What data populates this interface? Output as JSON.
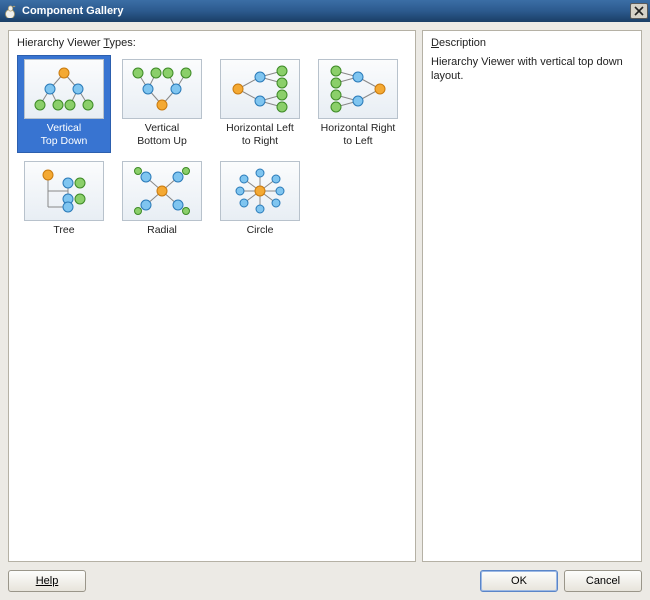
{
  "titlebar": {
    "title": "Component Gallery"
  },
  "leftPanel": {
    "label_prefix": "Hierarchy Viewer ",
    "label_accel": "T",
    "label_suffix": "ypes:"
  },
  "rightPanel": {
    "label_accel": "D",
    "label_suffix": "escription"
  },
  "description": "Hierarchy Viewer with vertical top down layout.",
  "gallery": [
    {
      "id": "vertical-top-down",
      "line1": "Vertical",
      "line2": "Top Down",
      "selected": true
    },
    {
      "id": "vertical-bottom-up",
      "line1": "Vertical",
      "line2": "Bottom Up",
      "selected": false
    },
    {
      "id": "horizontal-ltr",
      "line1": "Horizontal Left",
      "line2": "to Right",
      "selected": false
    },
    {
      "id": "horizontal-rtl",
      "line1": "Horizontal Right",
      "line2": "to Left",
      "selected": false
    },
    {
      "id": "tree",
      "line1": "Tree",
      "line2": "",
      "selected": false
    },
    {
      "id": "radial",
      "line1": "Radial",
      "line2": "",
      "selected": false
    },
    {
      "id": "circle",
      "line1": "Circle",
      "line2": "",
      "selected": false
    }
  ],
  "buttons": {
    "help": "Help",
    "ok": "OK",
    "cancel": "Cancel"
  }
}
